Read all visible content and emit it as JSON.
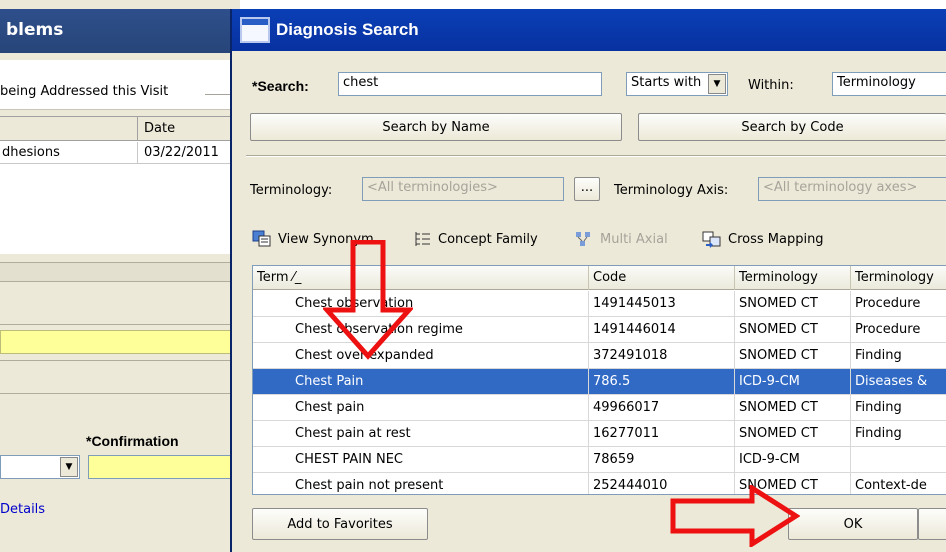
{
  "background_window": {
    "title": "blems",
    "group_label": "being Addressed this Visit",
    "table": {
      "date_header": "Date",
      "rows": [
        {
          "name": "dhesions",
          "date": "03/22/2011"
        }
      ]
    },
    "confirmation_label": "*Confirmation",
    "details_link": "Details"
  },
  "dialog": {
    "title": "Diagnosis Search",
    "search": {
      "label": "*Search:",
      "value": "chest",
      "mode": "Starts with",
      "within_label": "Within:",
      "within_value": "Terminology"
    },
    "buttons": {
      "search_by_name": "Search by Name",
      "search_by_code": "Search by Code",
      "ellipsis": "...",
      "add_to_favorites": "Add to Favorites",
      "ok": "OK"
    },
    "terminology": {
      "label": "Terminology:",
      "value": "<All terminologies>",
      "axis_label": "Terminology Axis:",
      "axis_value": "<All terminology axes>"
    },
    "toolbar": {
      "view_synonym": "View Synonym",
      "concept_family": "Concept Family",
      "multi_axial": "Multi Axial",
      "cross_mapping": "Cross Mapping"
    },
    "grid": {
      "columns": [
        "Term ⁄_",
        "Code",
        "Terminology",
        "Terminology"
      ],
      "rows": [
        {
          "term": "Chest observation",
          "code": "1491445013",
          "terminology": "SNOMED CT",
          "axis": "Procedure",
          "selected": false
        },
        {
          "term": "Chest observation regime",
          "code": "1491446014",
          "terminology": "SNOMED CT",
          "axis": "Procedure",
          "selected": false
        },
        {
          "term": "Chest over-expanded",
          "code": "372491018",
          "terminology": "SNOMED CT",
          "axis": "Finding",
          "selected": false
        },
        {
          "term": "Chest Pain",
          "code": "786.5",
          "terminology": "ICD-9-CM",
          "axis": "Diseases &",
          "selected": true
        },
        {
          "term": "Chest pain",
          "code": "49966017",
          "terminology": "SNOMED CT",
          "axis": "Finding",
          "selected": false
        },
        {
          "term": "Chest pain at rest",
          "code": "16277011",
          "terminology": "SNOMED CT",
          "axis": "Finding",
          "selected": false
        },
        {
          "term": "CHEST PAIN NEC",
          "code": "78659",
          "terminology": "ICD-9-CM",
          "axis": "",
          "selected": false
        },
        {
          "term": "Chest pain not present",
          "code": "252444010",
          "terminology": "SNOMED CT",
          "axis": "Context-de",
          "selected": false
        }
      ]
    }
  },
  "colors": {
    "selection": "#316ac5",
    "arrow": "#ee1111",
    "title_bar": "#0a3fb6",
    "required_field": "#ffff99"
  }
}
